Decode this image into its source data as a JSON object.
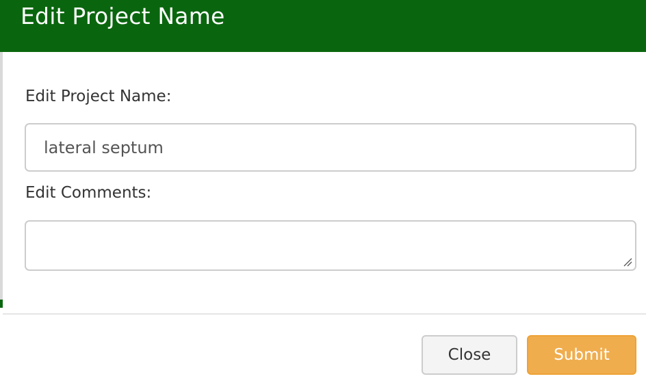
{
  "modal": {
    "title": "Edit Project Name",
    "header_color": "#0a660e"
  },
  "form": {
    "project_name_label": "Edit Project Name:",
    "project_name_value": "lateral septum",
    "comments_label": "Edit Comments:",
    "comments_value": ""
  },
  "footer": {
    "close_label": "Close",
    "submit_label": "Submit",
    "submit_color": "#f0ad4e"
  },
  "icons": {
    "textarea_resize": "resize-grip-icon"
  }
}
